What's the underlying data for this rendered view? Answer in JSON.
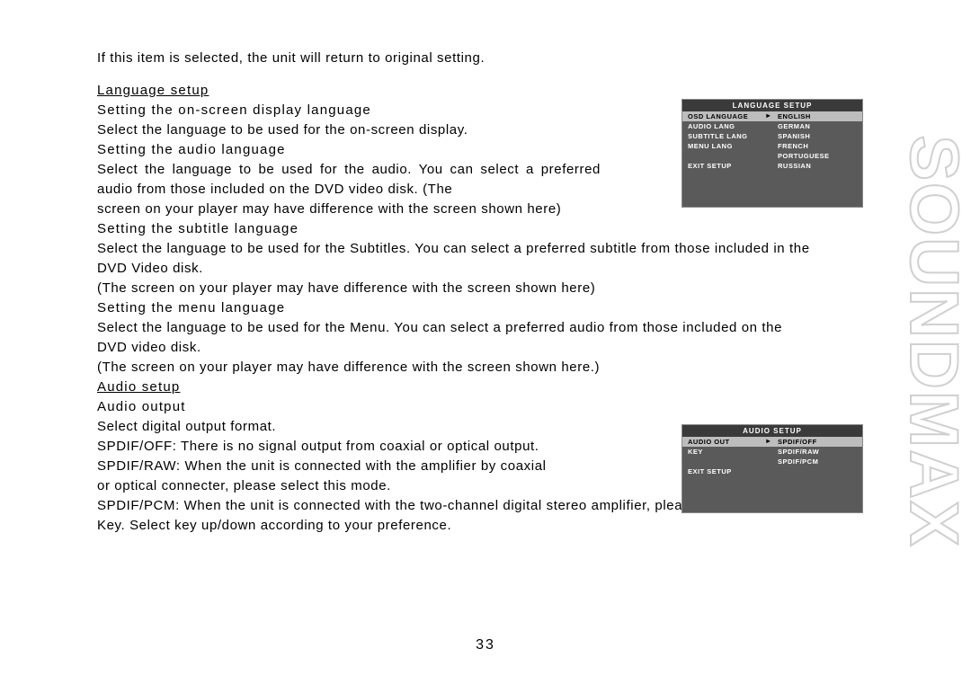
{
  "intro": "If this item is selected, the unit will return to original setting.",
  "lang": {
    "heading": "Language setup",
    "osd_sub": "Setting the on-screen display language",
    "osd_body": "Select the language to be used for the on-screen display.",
    "audio_sub": "Setting the audio language",
    "audio_body1": "Select the language to be used for the audio. You can select a preferred audio from those included on the DVD video disk. (The",
    "audio_body2": "screen on your player may have difference with the screen shown here)",
    "subtitle_sub": "Setting the subtitle language",
    "subtitle_body1": "Select the language to be used for the Subtitles. You can select a preferred subtitle from those included in the DVD Video disk.",
    "subtitle_body2": "(The screen on your player may have difference with the screen shown here)",
    "menu_sub": "Setting the menu language",
    "menu_body1": "Select the language to be used for the Menu. You can select a preferred audio from those included on the DVD video disk.",
    "menu_body2": "(The screen on your player may have difference with the screen shown here.)"
  },
  "audio": {
    "heading": "Audio setup",
    "out_sub": "Audio output",
    "out_body": "Select digital output format.",
    "spdif_off": "SPDIF/OFF: There is no signal output from coaxial or optical output.",
    "spdif_raw1": "SPDIF/RAW: When the unit is connected with the amplifier by coaxial",
    "spdif_raw2": "or optical connecter, please select this mode.",
    "spdif_pcm": "SPDIF/PCM: When the unit is connected with the two-channel digital stereo amplifier, please select this mode.",
    "key": "Key. Select key up/down according to your preference."
  },
  "osd1": {
    "title": "LANGUAGE SETUP",
    "left": [
      "OSD LANGUAGE",
      "AUDIO LANG",
      "SUBTITLE LANG",
      "MENU LANG",
      "",
      "EXIT SETUP"
    ],
    "right": [
      "ENGLISH",
      "GERMAN",
      "SPANISH",
      "FRENCH",
      "PORTUGUESE",
      "RUSSIAN"
    ]
  },
  "osd2": {
    "title": "AUDIO SETUP",
    "left": [
      "AUDIO OUT",
      "KEY",
      "",
      "EXIT SETUP"
    ],
    "right": [
      "SPDIF/OFF",
      "SPDIF/RAW",
      "SPDIF/PCM"
    ]
  },
  "brand": "SOUNDMAX",
  "pagenum": "33"
}
